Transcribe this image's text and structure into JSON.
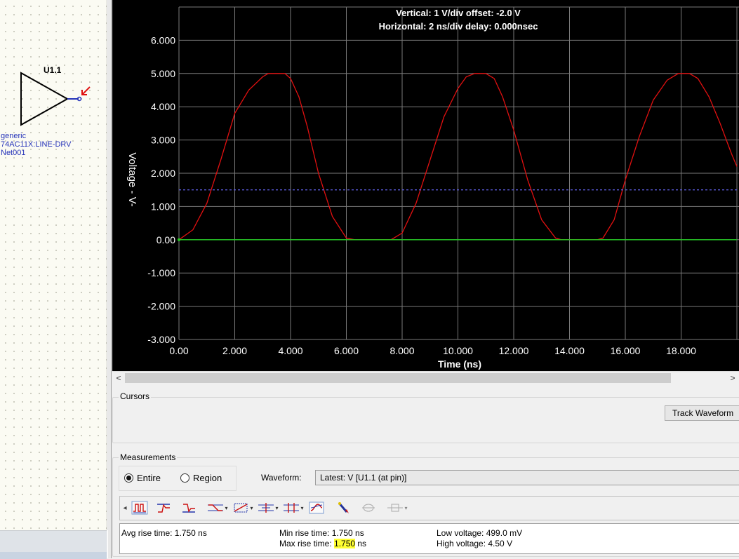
{
  "schematic": {
    "ref": "U1.1",
    "lines": [
      "generic",
      "74AC11X:LINE-DRV",
      "Net001"
    ]
  },
  "scope": {
    "header_vertical": "Vertical: 1  V/div  offset: -2.0 V",
    "header_horizontal": "Horizontal: 2 ns/div  delay: 0.000nsec",
    "ylabel": "Voltage  - V-",
    "xlabel": "Time  (ns)"
  },
  "chart_data": {
    "type": "line",
    "title": "",
    "xlabel": "Time  (ns)",
    "ylabel": "Voltage  - V-",
    "xlim": [
      0,
      20
    ],
    "ylim": [
      -3,
      7
    ],
    "x_ticks": [
      "0.00",
      "2.000",
      "4.000",
      "6.000",
      "8.000",
      "10.000",
      "12.000",
      "14.000",
      "16.000",
      "18.000"
    ],
    "y_ticks": [
      "6.000",
      "5.000",
      "4.000",
      "3.000",
      "2.000",
      "1.000",
      "0.00",
      "-1.000",
      "-2.000",
      "-3.000"
    ],
    "y_tick_values": [
      6,
      5,
      4,
      3,
      2,
      1,
      0,
      -1,
      -2,
      -3
    ],
    "grid": true,
    "series": [
      {
        "color": "#e01010",
        "x": [
          0,
          0.5,
          1.0,
          1.5,
          2.0,
          2.5,
          3.0,
          3.2,
          3.5,
          3.8,
          4.0,
          4.3,
          4.6,
          5.0,
          5.5,
          6.0,
          6.3,
          6.6,
          7.0,
          7.4,
          7.6,
          8.0,
          8.5,
          9.0,
          9.5,
          10.0,
          10.3,
          10.6,
          11.0,
          11.3,
          11.6,
          12.0,
          12.5,
          13.0,
          13.5,
          13.7,
          14.0,
          14.5,
          15.0,
          15.2,
          15.6,
          16.0,
          16.5,
          17.0,
          17.5,
          17.9,
          18.3,
          18.6,
          19.0,
          19.4,
          19.8,
          20.0
        ],
        "y": [
          0,
          0.3,
          1.1,
          2.4,
          3.8,
          4.5,
          4.9,
          5.0,
          5.0,
          5.0,
          4.85,
          4.3,
          3.4,
          2.0,
          0.7,
          0.05,
          0,
          0,
          0,
          0,
          0,
          0.2,
          1.1,
          2.4,
          3.7,
          4.55,
          4.9,
          5.0,
          5.0,
          4.85,
          4.3,
          3.3,
          1.8,
          0.6,
          0.05,
          0,
          0,
          0,
          0,
          0.05,
          0.6,
          1.8,
          3.1,
          4.2,
          4.8,
          5.0,
          5.0,
          4.85,
          4.3,
          3.5,
          2.6,
          2.2
        ]
      },
      {
        "color": "#22cc22",
        "x": [
          0,
          20
        ],
        "y": [
          0,
          0
        ]
      },
      {
        "color": "#5a5ad8",
        "dashed": true,
        "x": [
          0,
          20
        ],
        "y": [
          1.5,
          1.5
        ]
      }
    ]
  },
  "scroll": {
    "left": "<",
    "right": ">"
  },
  "cursors": {
    "label": "Cursors",
    "track_button": "Track Waveform"
  },
  "measurements": {
    "label": "Measurements",
    "mode_entire": "Entire",
    "mode_region": "Region",
    "mode_selected": "Entire",
    "waveform_label": "Waveform:",
    "waveform_value": "Latest: V [U1.1 (at pin)]",
    "toolbar_left_arrow": "◂",
    "results": {
      "avg_rise": "Avg rise time: 1.750 ns",
      "min_rise_label": "Min rise time: ",
      "min_rise_value": "1.750 ns",
      "max_rise_label": "Max rise time: ",
      "max_rise_value": "1.750",
      "max_rise_unit": " ns",
      "low_voltage": "Low voltage: 499.0 mV",
      "high_voltage": "High voltage: 4.50 V"
    }
  }
}
